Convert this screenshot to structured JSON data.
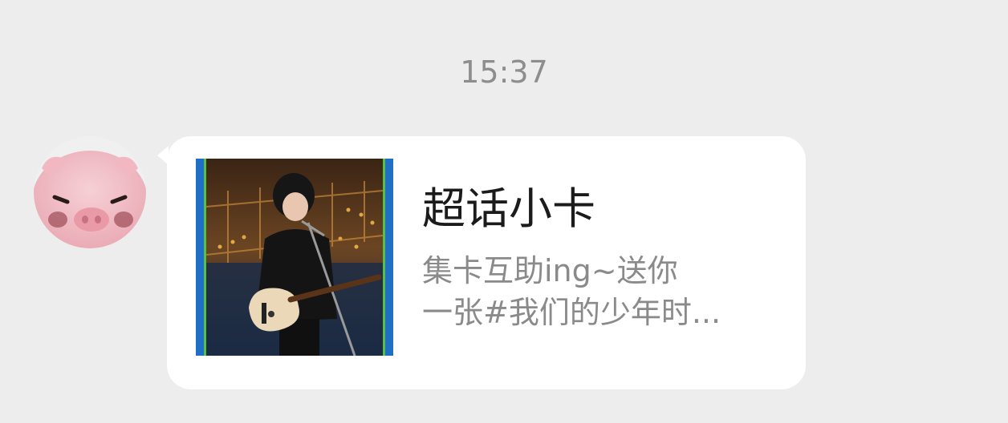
{
  "chat": {
    "timestamp": "15:37"
  },
  "message": {
    "sender_avatar": "pink-pig-avatar-icon",
    "card": {
      "title": "超话小卡",
      "description_line1": "集卡互助ing~送你",
      "description_line2": "一张#我们的少年时...",
      "thumbnail": "performer-with-bass-guitar-photo"
    }
  },
  "colors": {
    "background": "#ededed",
    "bubble": "#ffffff",
    "timestamp": "#8d8d8d",
    "title": "#1b1b1b",
    "description": "#8a8a8a",
    "thumb_border_blue": "#1f6fc4",
    "thumb_border_green": "#55c04a"
  }
}
